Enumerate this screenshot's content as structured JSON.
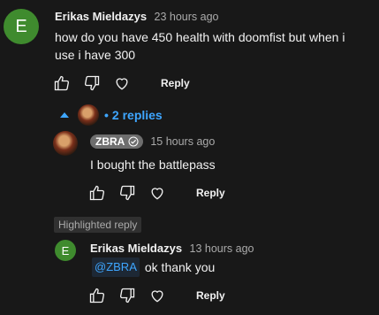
{
  "comment": {
    "avatar_letter": "E",
    "avatar_color": "#3f8b2e",
    "author": "Erikas Mieldazys",
    "time": "23 hours ago",
    "text_line1": "how do you have 450 health with doomfist but when i",
    "text_line2": "use i have 300",
    "reply_label": "Reply"
  },
  "replies_toggle": {
    "label": "2 replies",
    "color": "#3ea6ff"
  },
  "reply1": {
    "author_badge": "ZBRA",
    "time": "15 hours ago",
    "text": "I bought the battlepass",
    "reply_label": "Reply"
  },
  "highlighted": {
    "label": "Highlighted reply"
  },
  "reply2": {
    "avatar_letter": "E",
    "avatar_color": "#3f8b2e",
    "author": "Erikas Mieldazys",
    "time": "13 hours ago",
    "mention": "@ZBRA",
    "text": "ok thank you",
    "reply_label": "Reply"
  },
  "icons": [
    "like-icon",
    "dislike-icon",
    "heart-icon",
    "check-icon",
    "caret-up-icon"
  ]
}
